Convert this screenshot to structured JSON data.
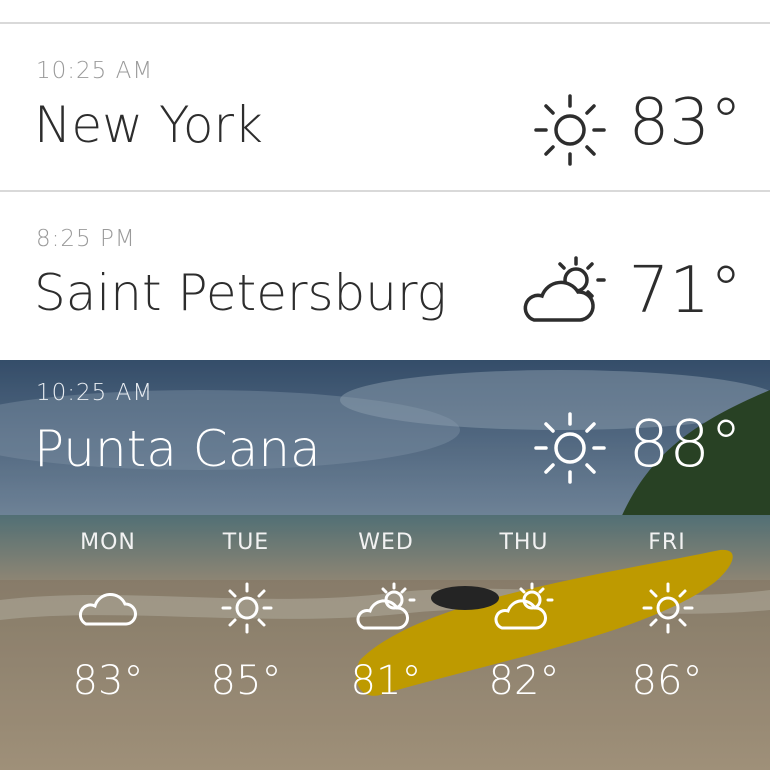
{
  "locations": [
    {
      "time": "10:25 AM",
      "city": "New York",
      "temp": "83°",
      "icon": "sun-icon"
    },
    {
      "time": "8:25 PM",
      "city": "Saint Petersburg",
      "temp": "71°",
      "icon": "partly-cloudy-icon"
    },
    {
      "time": "10:25 AM",
      "city": "Punta Cana",
      "temp": "88°",
      "icon": "sun-icon"
    }
  ],
  "forecast": [
    {
      "day": "MON",
      "temp": "83°",
      "icon": "cloud-icon"
    },
    {
      "day": "TUE",
      "temp": "85°",
      "icon": "sun-icon"
    },
    {
      "day": "WED",
      "temp": "81°",
      "icon": "partly-cloudy-icon"
    },
    {
      "day": "THU",
      "temp": "82°",
      "icon": "partly-cloudy-icon"
    },
    {
      "day": "FRI",
      "temp": "86°",
      "icon": "sun-icon"
    }
  ],
  "colors": {
    "text": "#2d2d2d",
    "muted": "#9a9a9a",
    "divider": "#d9d9d9",
    "hero_text": "#ffffff"
  }
}
